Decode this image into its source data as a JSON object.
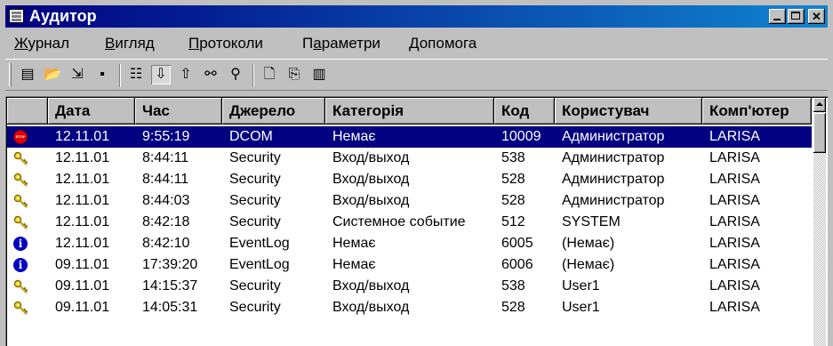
{
  "window": {
    "title": "Аудитор"
  },
  "menu": [
    {
      "u": "Ж",
      "rest": "урнал"
    },
    {
      "u": "В",
      "rest": "игляд"
    },
    {
      "u": "П",
      "rest": "ротоколи"
    },
    {
      "pre": "П",
      "u": "а",
      "rest": "раметри"
    },
    {
      "u": "Д",
      "rest": "опомога"
    }
  ],
  "toolbar": {
    "icons": [
      "log-icon",
      "open-folder-icon",
      "export-icon",
      "save-icon",
      "view-details-icon",
      "sort-descending-icon",
      "sort-ascending-icon",
      "find-icon",
      "find-next-icon",
      "page-icon",
      "copy-icon",
      "properties-icon"
    ]
  },
  "table": {
    "columns": [
      "Дата",
      "Час",
      "Джерело",
      "Категорія",
      "Код",
      "Користувач",
      "Комп'ютер"
    ],
    "rows": [
      {
        "icon": "stop",
        "date": "12.11.01",
        "time": "9:55:19",
        "source": "DCOM",
        "category": "Немає",
        "code": "10009",
        "user": "Администратор",
        "computer": "LARISA",
        "selected": true
      },
      {
        "icon": "key",
        "date": "12.11.01",
        "time": "8:44:11",
        "source": "Security",
        "category": "Вход/выход",
        "code": "538",
        "user": "Администратор",
        "computer": "LARISA"
      },
      {
        "icon": "key",
        "date": "12.11.01",
        "time": "8:44:11",
        "source": "Security",
        "category": "Вход/выход",
        "code": "528",
        "user": "Администратор",
        "computer": "LARISA"
      },
      {
        "icon": "key",
        "date": "12.11.01",
        "time": "8:44:03",
        "source": "Security",
        "category": "Вход/выход",
        "code": "528",
        "user": "Администратор",
        "computer": "LARISA"
      },
      {
        "icon": "key",
        "date": "12.11.01",
        "time": "8:42:18",
        "source": "Security",
        "category": "Системное событие",
        "code": "512",
        "user": "SYSTEM",
        "computer": "LARISA"
      },
      {
        "icon": "info",
        "date": "12.11.01",
        "time": "8:42:10",
        "source": "EventLog",
        "category": "Немає",
        "code": "6005",
        "user": "(Немає)",
        "computer": "LARISA"
      },
      {
        "icon": "info",
        "date": "09.11.01",
        "time": "17:39:20",
        "source": "EventLog",
        "category": "Немає",
        "code": "6006",
        "user": "(Немає)",
        "computer": "LARISA"
      },
      {
        "icon": "key",
        "date": "09.11.01",
        "time": "14:15:37",
        "source": "Security",
        "category": "Вход/выход",
        "code": "538",
        "user": "User1",
        "computer": "LARISA"
      },
      {
        "icon": "key",
        "date": "09.11.01",
        "time": "14:05:31",
        "source": "Security",
        "category": "Вход/выход",
        "code": "528",
        "user": "User1",
        "computer": "LARISA"
      }
    ]
  },
  "colors": {
    "titlebar": "#000080",
    "selection": "#000080",
    "face": "#c0c0c0"
  }
}
